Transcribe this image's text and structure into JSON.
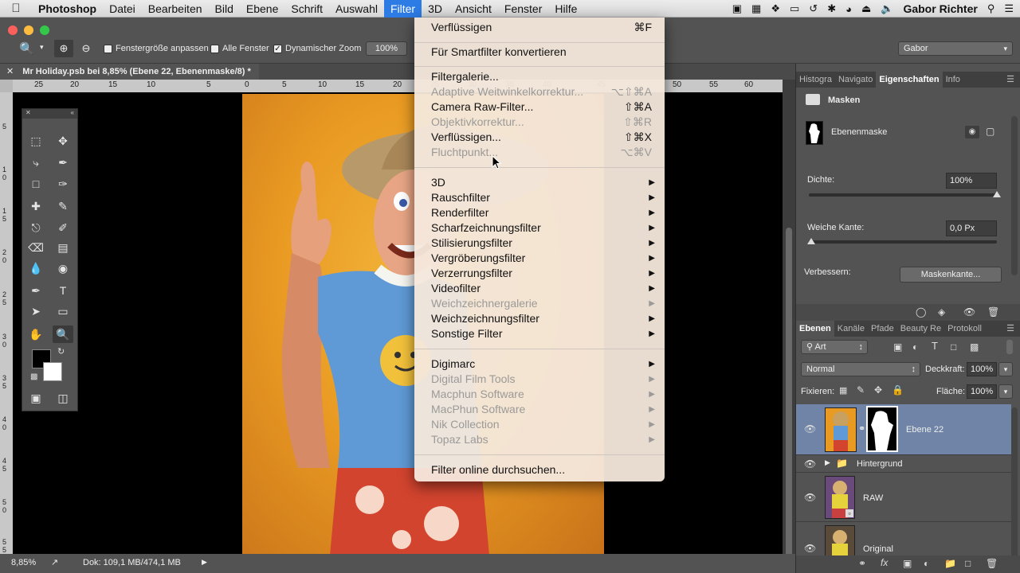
{
  "menubar": {
    "app": "Photoshop",
    "items": [
      "Datei",
      "Bearbeiten",
      "Bild",
      "Ebene",
      "Schrift",
      "Auswahl",
      "Filter",
      "3D",
      "Ansicht",
      "Fenster",
      "Hilfe"
    ],
    "active": "Filter",
    "user": "Gabor Richter"
  },
  "options": {
    "fit_window": "Fenstergröße anpassen",
    "all_windows": "Alle Fenster",
    "dynamic_zoom": "Dynamischer Zoom",
    "zoom_value": "100%",
    "workspace": "Gabor"
  },
  "document": {
    "tab_title": "Mr Holiday.psb bei 8,85% (Ebene 22, Ebenenmaske/8) *",
    "ruler_h": [
      "25",
      "20",
      "15",
      "10",
      "5",
      "0",
      "5",
      "10",
      "15",
      "20",
      "25",
      "30",
      "35",
      "40",
      "45",
      "50",
      "55",
      "60"
    ],
    "ruler_v": [
      "5",
      "1 0",
      "1 5",
      "2 0",
      "2 5",
      "3 0",
      "3 5",
      "4 0",
      "4 5",
      "5 0",
      "5 5"
    ]
  },
  "status": {
    "zoom": "8,85%",
    "doc": "Dok: 109,1 MB/474,1 MB"
  },
  "filter_menu": {
    "groups": [
      [
        {
          "label": "Verflüssigen",
          "shortcut": "⌘F",
          "disabled": false,
          "submenu": false
        }
      ],
      [
        {
          "label": "Für Smartfilter konvertieren",
          "shortcut": "",
          "disabled": false,
          "submenu": false
        }
      ],
      [
        {
          "label": "Filtergalerie...",
          "shortcut": "",
          "disabled": false,
          "submenu": false
        },
        {
          "label": "Adaptive Weitwinkelkorrektur...",
          "shortcut": "⌥⇧⌘A",
          "disabled": true,
          "submenu": false
        },
        {
          "label": "Camera Raw-Filter...",
          "shortcut": "⇧⌘A",
          "disabled": false,
          "submenu": false
        },
        {
          "label": "Objektivkorrektur...",
          "shortcut": "⇧⌘R",
          "disabled": true,
          "submenu": false
        },
        {
          "label": "Verflüssigen...",
          "shortcut": "⇧⌘X",
          "disabled": false,
          "submenu": false
        },
        {
          "label": "Fluchtpunkt...",
          "shortcut": "⌥⌘V",
          "disabled": true,
          "submenu": false
        }
      ],
      [
        {
          "label": "3D",
          "shortcut": "",
          "disabled": false,
          "submenu": true
        },
        {
          "label": "Rauschfilter",
          "shortcut": "",
          "disabled": false,
          "submenu": true
        },
        {
          "label": "Renderfilter",
          "shortcut": "",
          "disabled": false,
          "submenu": true
        },
        {
          "label": "Scharfzeichnungsfilter",
          "shortcut": "",
          "disabled": false,
          "submenu": true
        },
        {
          "label": "Stilisierungsfilter",
          "shortcut": "",
          "disabled": false,
          "submenu": true
        },
        {
          "label": "Vergröberungsfilter",
          "shortcut": "",
          "disabled": false,
          "submenu": true
        },
        {
          "label": "Verzerrungsfilter",
          "shortcut": "",
          "disabled": false,
          "submenu": true
        },
        {
          "label": "Videofilter",
          "shortcut": "",
          "disabled": false,
          "submenu": true
        },
        {
          "label": "Weichzeichnergalerie",
          "shortcut": "",
          "disabled": true,
          "submenu": true
        },
        {
          "label": "Weichzeichnungsfilter",
          "shortcut": "",
          "disabled": false,
          "submenu": true
        },
        {
          "label": "Sonstige Filter",
          "shortcut": "",
          "disabled": false,
          "submenu": true
        }
      ],
      [
        {
          "label": "Digimarc",
          "shortcut": "",
          "disabled": false,
          "submenu": true
        },
        {
          "label": "Digital Film Tools",
          "shortcut": "",
          "disabled": true,
          "submenu": true
        },
        {
          "label": "Macphun Software",
          "shortcut": "",
          "disabled": true,
          "submenu": true
        },
        {
          "label": "MacPhun Software",
          "shortcut": "",
          "disabled": true,
          "submenu": true
        },
        {
          "label": "Nik Collection",
          "shortcut": "",
          "disabled": true,
          "submenu": true
        },
        {
          "label": "Topaz Labs",
          "shortcut": "",
          "disabled": true,
          "submenu": true
        }
      ],
      [
        {
          "label": "Filter online durchsuchen...",
          "shortcut": "",
          "disabled": false,
          "submenu": false
        }
      ]
    ]
  },
  "properties_panel": {
    "tabs": [
      "Histogra",
      "Navigato",
      "Eigenschaften",
      "Info"
    ],
    "active_tab": "Eigenschaften",
    "section": "Masken",
    "mask_name": "Ebenenmaske",
    "density_label": "Dichte:",
    "density_value": "100%",
    "density_level": 1.0,
    "feather_label": "Weiche Kante:",
    "feather_value": "0,0 Px",
    "refine_label": "Verbessern:",
    "refine_button": "Maskenkante..."
  },
  "layers_panel": {
    "tabs": [
      "Ebenen",
      "Kanäle",
      "Pfade",
      "Beauty Re",
      "Protokoll"
    ],
    "active_tab": "Ebenen",
    "filter_kind": "Art",
    "blend_mode": "Normal",
    "opacity_label": "Deckkraft:",
    "opacity_value": "100%",
    "lock_label": "Fixieren:",
    "fill_label": "Fläche:",
    "fill_value": "100%",
    "layers": [
      {
        "name": "Ebene 22",
        "selected": true
      },
      {
        "name": "Hintergrund",
        "selected": false
      },
      {
        "name": "RAW",
        "selected": false
      },
      {
        "name": "Original",
        "selected": false
      }
    ]
  },
  "colors": {
    "menu_highlight": "#2d7be5",
    "panel_bg": "#535353",
    "selected_layer": "#6f84a6",
    "art_bg": "#e99a22"
  }
}
